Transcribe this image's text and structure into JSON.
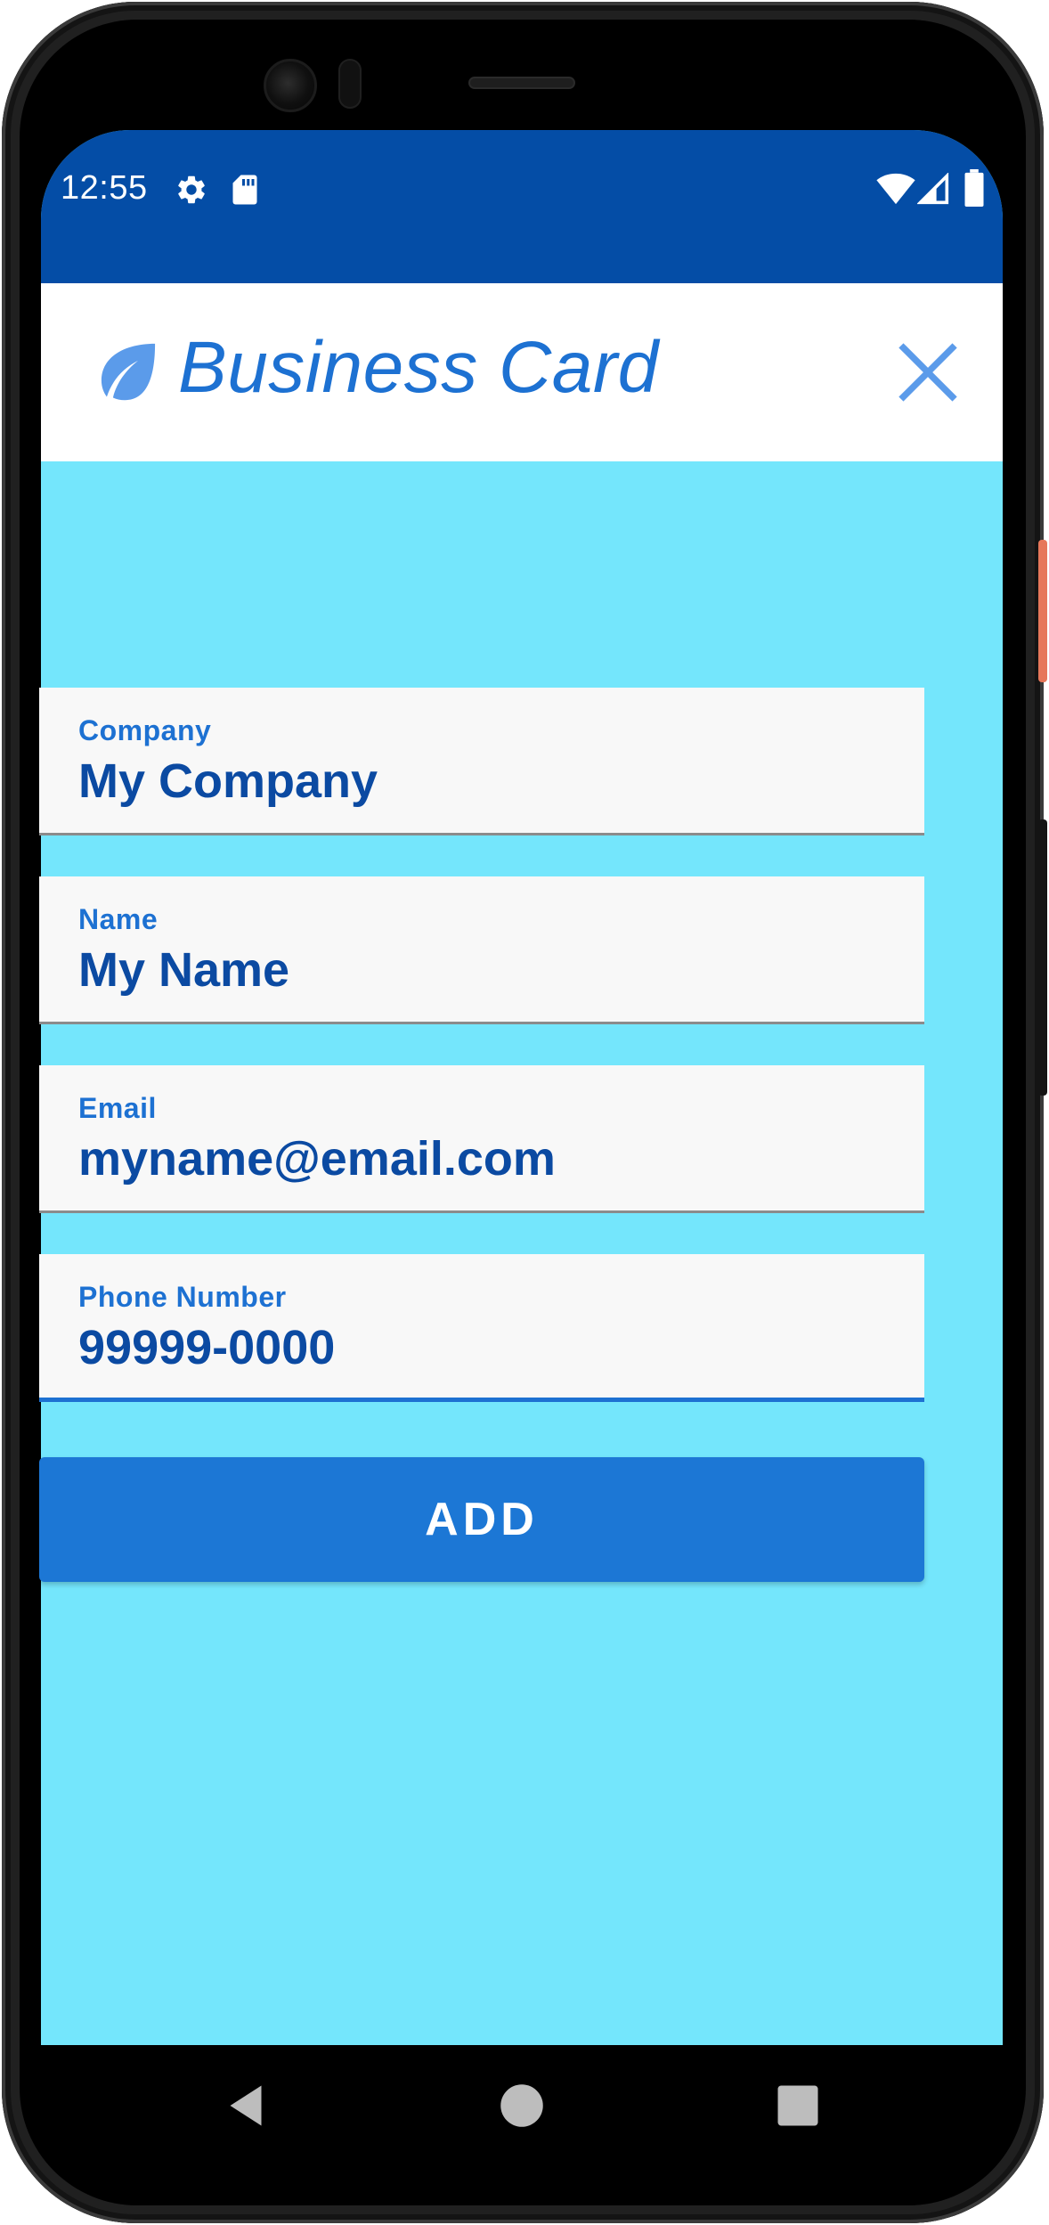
{
  "status_bar": {
    "time": "12:55",
    "left_icons": [
      "settings-icon",
      "sd-card-icon"
    ],
    "right_icons": [
      "wifi-icon",
      "cell-signal-icon",
      "battery-icon"
    ],
    "background_color": "#044da6"
  },
  "app_bar": {
    "logo_icon": "leaf-icon",
    "title": "Business Card",
    "close_icon": "close-icon",
    "title_color": "#1d71d2"
  },
  "form": {
    "background_color": "#74e6fc",
    "fields": [
      {
        "label": "Company",
        "value": "My Company"
      },
      {
        "label": "Name",
        "value": "My Name"
      },
      {
        "label": "Email",
        "value": "myname@email.com"
      },
      {
        "label": "Phone Number",
        "value": "99999-0000",
        "focused": true
      }
    ],
    "add_button_label": "ADD",
    "accent_color": "#1c77d5"
  },
  "nav_bar": {
    "icons": [
      "back-icon",
      "home-icon",
      "recents-icon"
    ]
  }
}
